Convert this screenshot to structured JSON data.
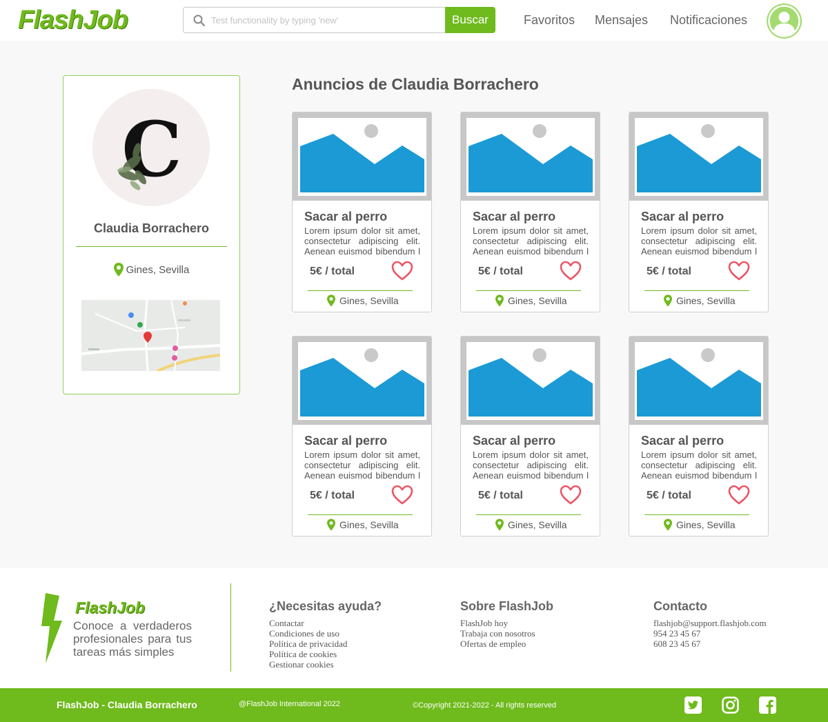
{
  "header": {
    "logo": "FlashJob",
    "search_placeholder": "Test functionality by typing 'new'",
    "search_button": "Buscar",
    "nav": [
      "Favoritos",
      "Mensajes",
      "Notificaciones"
    ]
  },
  "profile": {
    "name": "Claudia Borrachero",
    "location": "Gines, Sevilla"
  },
  "ads": {
    "title": "Anuncios de Claudia Borrachero",
    "cards": [
      {
        "title": "Sacar al perro",
        "desc": "Lorem ipsum dolor sit amet, consectetur adipiscing elit. Aenean euismod bibendum l",
        "price": "5€ / total",
        "location": "Gines, Sevilla"
      },
      {
        "title": "Sacar al perro",
        "desc": "Lorem ipsum dolor sit amet, consectetur adipiscing elit. Aenean euismod bibendum l",
        "price": "5€ / total",
        "location": "Gines, Sevilla"
      },
      {
        "title": "Sacar al perro",
        "desc": "Lorem ipsum dolor sit amet, consectetur adipiscing elit. Aenean euismod bibendum l",
        "price": "5€ / total",
        "location": "Gines, Sevilla"
      },
      {
        "title": "Sacar al perro",
        "desc": "Lorem ipsum dolor sit amet, consectetur adipiscing elit. Aenean euismod bibendum l",
        "price": "5€ / total",
        "location": "Gines, Sevilla"
      },
      {
        "title": "Sacar al perro",
        "desc": "Lorem ipsum dolor sit amet, consectetur adipiscing elit. Aenean euismod bibendum l",
        "price": "5€ / total",
        "location": "Gines, Sevilla"
      },
      {
        "title": "Sacar al perro",
        "desc": "Lorem ipsum dolor sit amet, consectetur adipiscing elit. Aenean euismod bibendum l",
        "price": "5€ / total",
        "location": "Gines, Sevilla"
      }
    ]
  },
  "footer": {
    "logo": "FlashJob",
    "tagline": [
      "Conoce a verdaderos",
      "profesionales para tus",
      "tareas más simples"
    ],
    "help": {
      "title": "¿Necesitas ayuda?",
      "links": [
        "Contactar",
        "Condiciones de uso",
        "Política de privacidad",
        "Política de cookies",
        "Gestionar cookies"
      ]
    },
    "about": {
      "title": "Sobre FlashJob",
      "links": [
        "FlashJob hoy",
        "Trabaja con nosotros",
        "Ofertas de empleo"
      ]
    },
    "contact": {
      "title": "Contacto",
      "lines": [
        "flashjob@support.flashjob.com",
        "954 23 45 67",
        "608 23 45 67"
      ]
    }
  },
  "bottom_bar": {
    "left": "FlashJob - Claudia Borrachero",
    "middle": "@FlashJob International 2022",
    "copyright": "©Copyright  2021-2022 - All rights reserved",
    "social_icons": [
      "twitter-icon",
      "instagram-icon",
      "facebook-icon"
    ]
  },
  "colors": {
    "brand_green": "#6fba1c",
    "placeholder_blue": "#1b9ad6",
    "heart_red": "#ec5566"
  }
}
